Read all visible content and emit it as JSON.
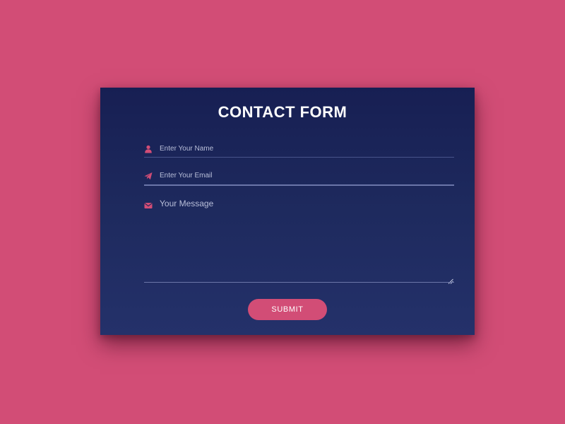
{
  "colors": {
    "background": "#d24d76",
    "card": "#1c275c",
    "accent": "#d24d76",
    "text": "#ffffff",
    "placeholder": "#b9bfd9"
  },
  "form": {
    "title": "CONTACT FORM",
    "fields": [
      {
        "icon": "user-icon",
        "placeholder": "Enter Your Name",
        "value": ""
      },
      {
        "icon": "paper-plane-icon",
        "placeholder": "Enter Your Email",
        "value": ""
      },
      {
        "icon": "envelope-icon",
        "placeholder": "Your Message",
        "value": ""
      }
    ],
    "submit_label": "SUBMIT"
  }
}
